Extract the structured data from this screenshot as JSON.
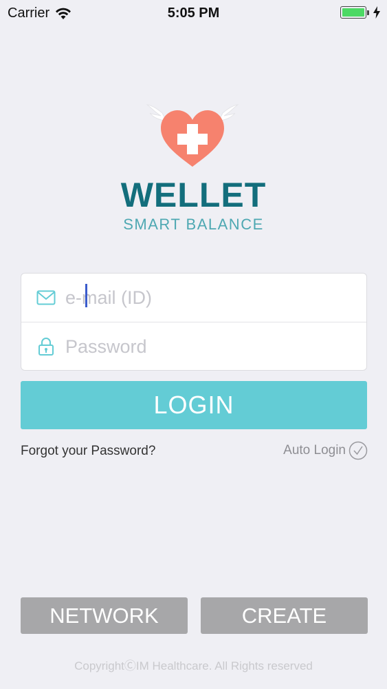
{
  "status_bar": {
    "carrier": "Carrier",
    "time": "5:05 PM",
    "battery_level": 100
  },
  "brand": {
    "name": "WELLET",
    "tagline": "SMART BALANCE",
    "heart_color": "#f6826e",
    "primary_color": "#136e7c",
    "accent_color": "#63ccd5"
  },
  "form": {
    "email": {
      "icon": "envelope-icon",
      "placeholder": "e-mail (ID)",
      "value": ""
    },
    "password": {
      "icon": "lock-icon",
      "placeholder": "Password",
      "value": ""
    }
  },
  "actions": {
    "login_label": "LOGIN",
    "forgot_password": "Forgot your Password?",
    "auto_login": "Auto Login",
    "network_label": "NETWORK",
    "create_label": "CREATE"
  },
  "footer": {
    "copyright": "CopyrightⒸIM Healthcare. All Rights reserved"
  }
}
